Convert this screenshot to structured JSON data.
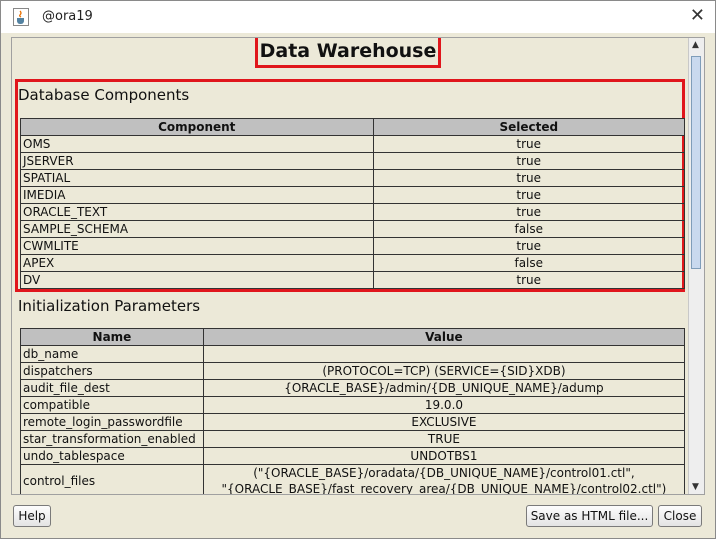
{
  "window": {
    "title": "@ora19",
    "close_glyph": "✕"
  },
  "page": {
    "heading": "Data Warehouse"
  },
  "components": {
    "section_title": "Database Components",
    "headers": [
      "Component",
      "Selected"
    ],
    "rows": [
      [
        "OMS",
        "true"
      ],
      [
        "JSERVER",
        "true"
      ],
      [
        "SPATIAL",
        "true"
      ],
      [
        "IMEDIA",
        "true"
      ],
      [
        "ORACLE_TEXT",
        "true"
      ],
      [
        "SAMPLE_SCHEMA",
        "false"
      ],
      [
        "CWMLITE",
        "true"
      ],
      [
        "APEX",
        "false"
      ],
      [
        "DV",
        "true"
      ]
    ]
  },
  "parameters": {
    "section_title": "Initialization Parameters",
    "headers": [
      "Name",
      "Value"
    ],
    "rows": [
      [
        "db_name",
        ""
      ],
      [
        "dispatchers",
        "(PROTOCOL=TCP) (SERVICE={SID}XDB)"
      ],
      [
        "audit_file_dest",
        "{ORACLE_BASE}/admin/{DB_UNIQUE_NAME}/adump"
      ],
      [
        "compatible",
        "19.0.0"
      ],
      [
        "remote_login_passwordfile",
        "EXCLUSIVE"
      ],
      [
        "star_transformation_enabled",
        "TRUE"
      ],
      [
        "undo_tablespace",
        "UNDOTBS1"
      ],
      [
        "control_files",
        "(\"{ORACLE_BASE}/oradata/{DB_UNIQUE_NAME}/control01.ctl\",\n\"{ORACLE_BASE}/fast_recovery_area/{DB_UNIQUE_NAME}/control02.ctl\")"
      ]
    ]
  },
  "buttons": {
    "help": "Help",
    "save": "Save as HTML file...",
    "close": "Close"
  },
  "icons": {
    "app": "java-cup-icon",
    "scroll_up": "scroll-up-arrow-icon",
    "scroll_down": "scroll-down-arrow-icon"
  },
  "colors": {
    "highlight": "#e0161c",
    "dialog_bg": "#ece9d8",
    "header_bg": "#c0c0c0"
  }
}
